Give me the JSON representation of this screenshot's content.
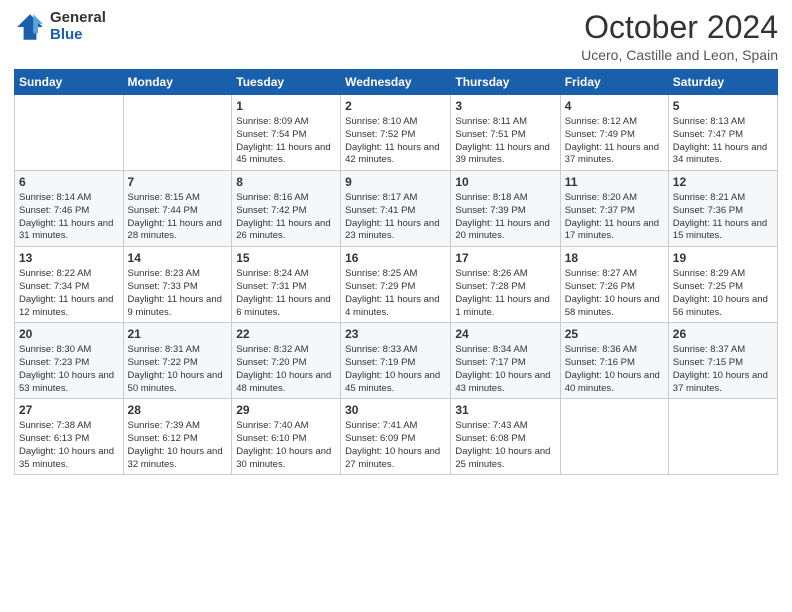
{
  "header": {
    "logo_general": "General",
    "logo_blue": "Blue",
    "month_title": "October 2024",
    "location": "Ucero, Castille and Leon, Spain"
  },
  "weekdays": [
    "Sunday",
    "Monday",
    "Tuesday",
    "Wednesday",
    "Thursday",
    "Friday",
    "Saturday"
  ],
  "weeks": [
    [
      {
        "day": "",
        "info": ""
      },
      {
        "day": "",
        "info": ""
      },
      {
        "day": "1",
        "info": "Sunrise: 8:09 AM\nSunset: 7:54 PM\nDaylight: 11 hours and 45 minutes."
      },
      {
        "day": "2",
        "info": "Sunrise: 8:10 AM\nSunset: 7:52 PM\nDaylight: 11 hours and 42 minutes."
      },
      {
        "day": "3",
        "info": "Sunrise: 8:11 AM\nSunset: 7:51 PM\nDaylight: 11 hours and 39 minutes."
      },
      {
        "day": "4",
        "info": "Sunrise: 8:12 AM\nSunset: 7:49 PM\nDaylight: 11 hours and 37 minutes."
      },
      {
        "day": "5",
        "info": "Sunrise: 8:13 AM\nSunset: 7:47 PM\nDaylight: 11 hours and 34 minutes."
      }
    ],
    [
      {
        "day": "6",
        "info": "Sunrise: 8:14 AM\nSunset: 7:46 PM\nDaylight: 11 hours and 31 minutes."
      },
      {
        "day": "7",
        "info": "Sunrise: 8:15 AM\nSunset: 7:44 PM\nDaylight: 11 hours and 28 minutes."
      },
      {
        "day": "8",
        "info": "Sunrise: 8:16 AM\nSunset: 7:42 PM\nDaylight: 11 hours and 26 minutes."
      },
      {
        "day": "9",
        "info": "Sunrise: 8:17 AM\nSunset: 7:41 PM\nDaylight: 11 hours and 23 minutes."
      },
      {
        "day": "10",
        "info": "Sunrise: 8:18 AM\nSunset: 7:39 PM\nDaylight: 11 hours and 20 minutes."
      },
      {
        "day": "11",
        "info": "Sunrise: 8:20 AM\nSunset: 7:37 PM\nDaylight: 11 hours and 17 minutes."
      },
      {
        "day": "12",
        "info": "Sunrise: 8:21 AM\nSunset: 7:36 PM\nDaylight: 11 hours and 15 minutes."
      }
    ],
    [
      {
        "day": "13",
        "info": "Sunrise: 8:22 AM\nSunset: 7:34 PM\nDaylight: 11 hours and 12 minutes."
      },
      {
        "day": "14",
        "info": "Sunrise: 8:23 AM\nSunset: 7:33 PM\nDaylight: 11 hours and 9 minutes."
      },
      {
        "day": "15",
        "info": "Sunrise: 8:24 AM\nSunset: 7:31 PM\nDaylight: 11 hours and 6 minutes."
      },
      {
        "day": "16",
        "info": "Sunrise: 8:25 AM\nSunset: 7:29 PM\nDaylight: 11 hours and 4 minutes."
      },
      {
        "day": "17",
        "info": "Sunrise: 8:26 AM\nSunset: 7:28 PM\nDaylight: 11 hours and 1 minute."
      },
      {
        "day": "18",
        "info": "Sunrise: 8:27 AM\nSunset: 7:26 PM\nDaylight: 10 hours and 58 minutes."
      },
      {
        "day": "19",
        "info": "Sunrise: 8:29 AM\nSunset: 7:25 PM\nDaylight: 10 hours and 56 minutes."
      }
    ],
    [
      {
        "day": "20",
        "info": "Sunrise: 8:30 AM\nSunset: 7:23 PM\nDaylight: 10 hours and 53 minutes."
      },
      {
        "day": "21",
        "info": "Sunrise: 8:31 AM\nSunset: 7:22 PM\nDaylight: 10 hours and 50 minutes."
      },
      {
        "day": "22",
        "info": "Sunrise: 8:32 AM\nSunset: 7:20 PM\nDaylight: 10 hours and 48 minutes."
      },
      {
        "day": "23",
        "info": "Sunrise: 8:33 AM\nSunset: 7:19 PM\nDaylight: 10 hours and 45 minutes."
      },
      {
        "day": "24",
        "info": "Sunrise: 8:34 AM\nSunset: 7:17 PM\nDaylight: 10 hours and 43 minutes."
      },
      {
        "day": "25",
        "info": "Sunrise: 8:36 AM\nSunset: 7:16 PM\nDaylight: 10 hours and 40 minutes."
      },
      {
        "day": "26",
        "info": "Sunrise: 8:37 AM\nSunset: 7:15 PM\nDaylight: 10 hours and 37 minutes."
      }
    ],
    [
      {
        "day": "27",
        "info": "Sunrise: 7:38 AM\nSunset: 6:13 PM\nDaylight: 10 hours and 35 minutes."
      },
      {
        "day": "28",
        "info": "Sunrise: 7:39 AM\nSunset: 6:12 PM\nDaylight: 10 hours and 32 minutes."
      },
      {
        "day": "29",
        "info": "Sunrise: 7:40 AM\nSunset: 6:10 PM\nDaylight: 10 hours and 30 minutes."
      },
      {
        "day": "30",
        "info": "Sunrise: 7:41 AM\nSunset: 6:09 PM\nDaylight: 10 hours and 27 minutes."
      },
      {
        "day": "31",
        "info": "Sunrise: 7:43 AM\nSunset: 6:08 PM\nDaylight: 10 hours and 25 minutes."
      },
      {
        "day": "",
        "info": ""
      },
      {
        "day": "",
        "info": ""
      }
    ]
  ]
}
